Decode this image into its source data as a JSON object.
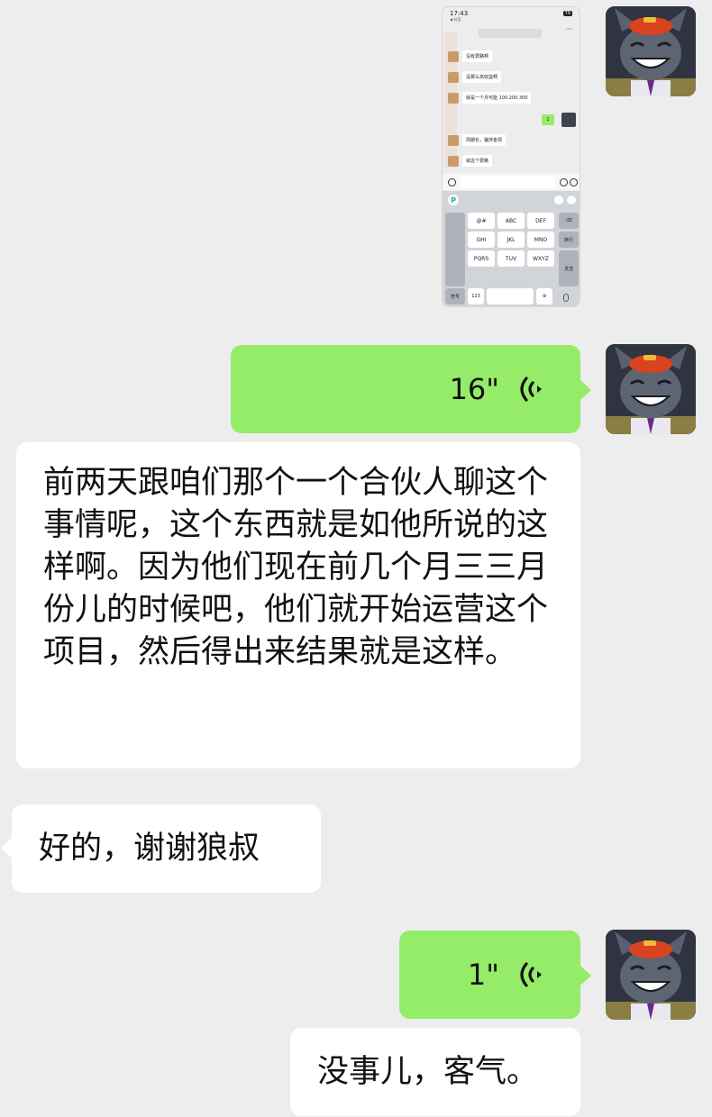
{
  "messages": {
    "voice1": {
      "duration": "16\""
    },
    "text_long": "前两天跟咱们那个一个合伙人聊这个事情呢，这个东西就是如他所说的这样啊。因为他们现在前几个月三三月份儿的时候吧，他们就开始运营这个项目，然后得出来结果就是这样。",
    "reply": "好的，谢谢狼叔",
    "voice2": {
      "duration": "1\""
    },
    "text_last": "没事儿，客气。"
  },
  "screenshot": {
    "time": "17:43",
    "back": "◀ 抖音",
    "battery": "79",
    "more": "···",
    "lines": [
      "没有费路啊",
      "没那么高收益啊",
      "就是一个月可能 100.200.300",
      "周期长，骗拌金领",
      "就这个费路"
    ],
    "green_bubble": "1",
    "keyboard": {
      "row1": [
        "@#",
        "ABC",
        "DEF"
      ],
      "row2": [
        "GHI",
        "JKL",
        "MNO"
      ],
      "row3": [
        "PQRS",
        "TUV",
        "WXYZ"
      ],
      "left_keys": [
        ",",
        "。",
        "?",
        "!"
      ],
      "newline": "换行",
      "send": "发送",
      "symbol": "符号",
      "num": "123"
    }
  },
  "colors": {
    "green": "#95ec69",
    "background": "#ededed",
    "white": "#ffffff"
  }
}
